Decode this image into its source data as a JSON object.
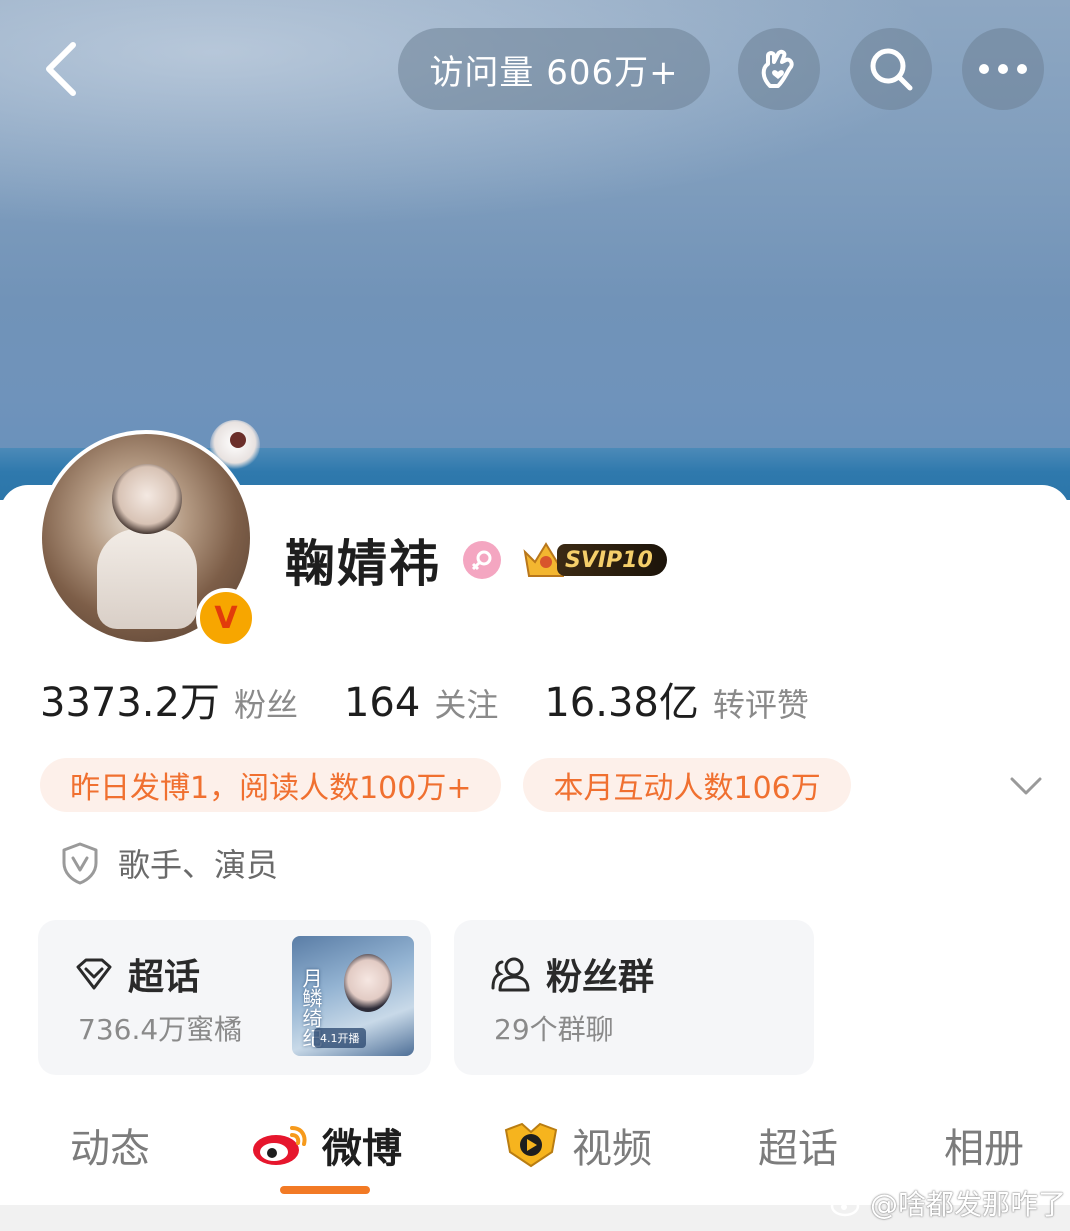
{
  "header": {
    "visits_label": "访问量 606万+",
    "icons": [
      "back-arrow-icon",
      "hand-heart-icon",
      "search-icon",
      "more-icon"
    ]
  },
  "profile": {
    "name": "鞠婧祎",
    "gender_icon": "female-icon",
    "svip_label": "SVIP10",
    "verified_icon": "verified-v-icon"
  },
  "stats": [
    {
      "value": "3373.2万",
      "label": "粉丝"
    },
    {
      "value": "164",
      "label": "关注"
    },
    {
      "value": "16.38亿",
      "label": "转评赞"
    }
  ],
  "highlights": [
    "昨日发博1，阅读人数100万+",
    "本月互动人数106万"
  ],
  "role": "歌手、演员",
  "tiles": {
    "supertopic": {
      "title": "超话",
      "subtitle": "736.4万蜜橘",
      "poster_caption": "月鳞绮纪",
      "poster_tag": "4.1开播"
    },
    "fangroup": {
      "title": "粉丝群",
      "subtitle": "29个群聊"
    }
  },
  "tabs": [
    "动态",
    "微博",
    "视频",
    "超话",
    "相册"
  ],
  "active_tab": "微博",
  "watermark": "@啥都发那咋了",
  "colors": {
    "accent": "#f27a25",
    "pill_text": "#f07030",
    "pill_bg": "#fdf0ea",
    "gender": "#f4a6c1"
  }
}
